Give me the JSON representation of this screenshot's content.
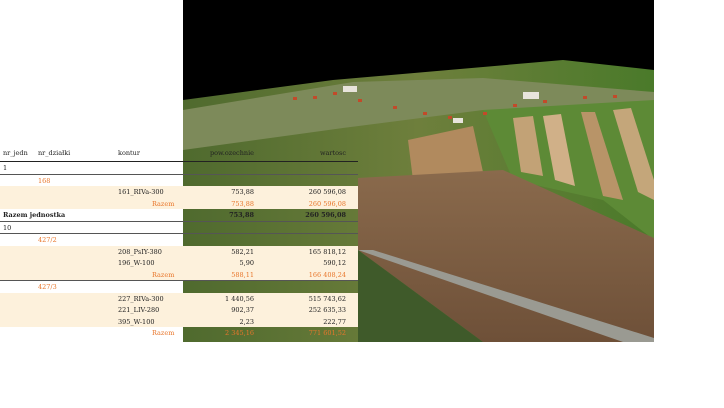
{
  "table": {
    "headers": {
      "nr_jedn": "nr_jedn",
      "nr_dzialki": "nr_działki",
      "kontur": "kontur",
      "pow": "pow.ozechnie",
      "wartosc": "wartosc"
    },
    "rows": [
      {
        "type": "unit",
        "nr_jedn": "1"
      },
      {
        "type": "parcel",
        "nr_dzialki": "168"
      },
      {
        "type": "item",
        "kontur": "161_RIVa-300",
        "pow": "753,88",
        "wartosc": "260 596,08"
      },
      {
        "type": "subtotal",
        "label": "Razem",
        "pow": "753,88",
        "wartosc": "260 596,08"
      },
      {
        "type": "unit_total",
        "label": "Razem jednostka",
        "pow": "753,88",
        "wartosc": "260 596,08"
      },
      {
        "type": "unit",
        "nr_jedn": "10"
      },
      {
        "type": "parcel",
        "nr_dzialki": "427/2"
      },
      {
        "type": "item",
        "kontur": "208_PsIY-380",
        "pow": "582,21",
        "wartosc": "165 818,12"
      },
      {
        "type": "item",
        "kontur": "196_W-100",
        "pow": "5,90",
        "wartosc": "590,12"
      },
      {
        "type": "subtotal",
        "label": "Razem",
        "pow": "588,11",
        "wartosc": "166 408,24"
      },
      {
        "type": "parcel",
        "nr_dzialki": "427/3"
      },
      {
        "type": "item",
        "kontur": "227_RIVa-300",
        "pow": "1 440,56",
        "wartosc": "515 743,62"
      },
      {
        "type": "item",
        "kontur": "221_LIV-280",
        "pow": "902,37",
        "wartosc": "252 635,33"
      },
      {
        "type": "item",
        "kontur": "395_W-100",
        "pow": "2,23",
        "wartosc": "222,77"
      },
      {
        "type": "subtotal",
        "label": "Razem",
        "pow": "2 345,16",
        "wartosc": "771 601,52"
      }
    ]
  },
  "colors": {
    "accent_orange": "#e8762b",
    "row_shade": "#fdf1dc"
  }
}
